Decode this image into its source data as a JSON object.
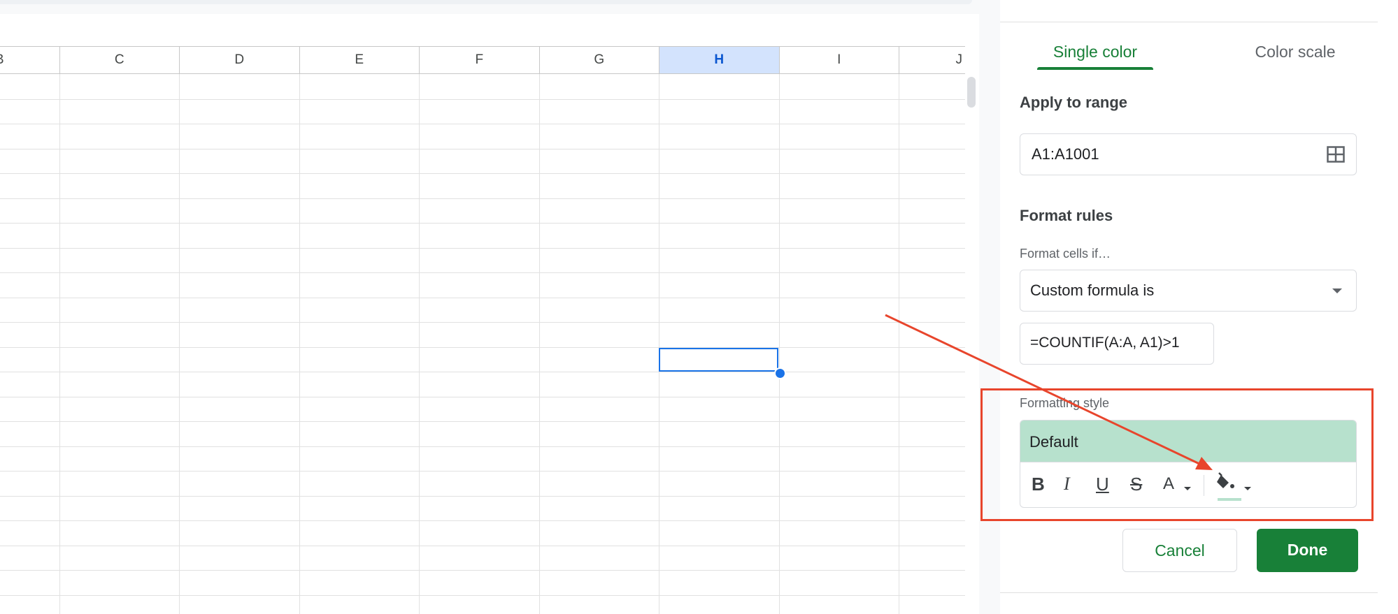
{
  "sheet": {
    "columns": [
      {
        "label": "B",
        "selected": false
      },
      {
        "label": "C",
        "selected": false
      },
      {
        "label": "D",
        "selected": false
      },
      {
        "label": "E",
        "selected": false
      },
      {
        "label": "F",
        "selected": false
      },
      {
        "label": "G",
        "selected": false
      },
      {
        "label": "H",
        "selected": true
      },
      {
        "label": "I",
        "selected": false
      },
      {
        "label": "J",
        "selected": false
      }
    ]
  },
  "panel": {
    "tabs": {
      "single_color": "Single color",
      "color_scale": "Color scale"
    },
    "apply_to_range": {
      "title": "Apply to range",
      "value": "A1:A1001"
    },
    "format_rules": {
      "title": "Format rules",
      "condition_label": "Format cells if…",
      "condition_value": "Custom formula is",
      "formula_value": "=COUNTIF(A:A, A1)>1"
    },
    "formatting_style": {
      "label": "Formatting style",
      "preview_label": "Default",
      "text_color_glyph": "A",
      "preview_color": "#b7e1cd"
    },
    "buttons": {
      "cancel": "Cancel",
      "done": "Done"
    }
  },
  "annotation": {
    "color": "#e8452c"
  }
}
